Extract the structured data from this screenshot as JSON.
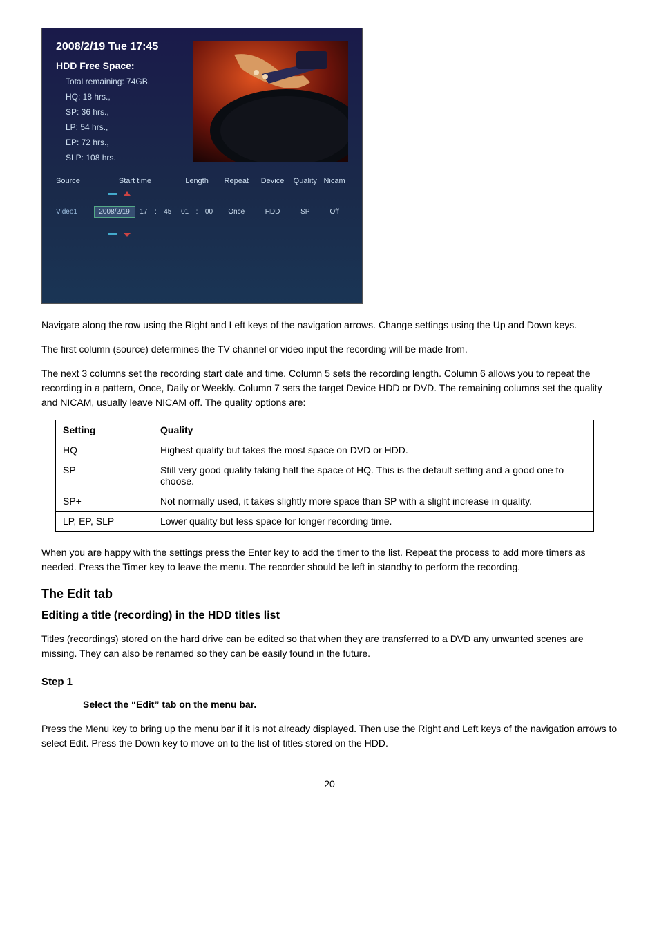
{
  "screenshot": {
    "datetime": "2008/2/19 Tue 17:45",
    "freespace_title": "HDD Free Space:",
    "lines": {
      "total": "Total remaining: 74GB.",
      "hq": "HQ: 18 hrs.,",
      "sp": "SP: 36 hrs.,",
      "lp": "LP: 54 hrs.,",
      "ep": "EP: 72 hrs.,",
      "slp": "SLP: 108 hrs."
    },
    "headers": {
      "source": "Source",
      "start_time": "Start time",
      "length": "Length",
      "repeat": "Repeat",
      "device": "Device",
      "quality": "Quality",
      "nicam": "Nicam"
    },
    "row": {
      "source": "Video1",
      "date": "2008/2/19",
      "hh": "17",
      "sep": ":",
      "mm": "45",
      "len_hh": "01",
      "len_mm": "00",
      "repeat": "Once",
      "device": "HDD",
      "quality": "SP",
      "nicam": "Off"
    }
  },
  "paragraphs": {
    "p1": "Navigate along the row using the Right and Left keys of the navigation arrows. Change settings using the Up and Down keys.",
    "p2": "The first column (source) determines the TV channel or video input the recording will be made from.",
    "p3": "The next 3 columns set the recording start date and time. Column 5 sets the recording length. Column 6 allows you to repeat the recording in a pattern, Once, Daily or Weekly. Column 7 sets the target Device HDD or DVD. The remaining columns set the quality and NICAM, usually leave NICAM off. The quality options are:",
    "p4": "When you are happy with the settings press the Enter key to add the timer to the list. Repeat the process to add more timers as needed. Press the Timer key to leave the menu. The recorder should be left in standby to perform the recording."
  },
  "quality_table": {
    "head_setting": "Setting",
    "head_quality": "Quality",
    "rows": [
      {
        "setting": "HQ",
        "quality": "Highest quality but takes the most space on DVD or HDD."
      },
      {
        "setting": "SP",
        "quality": "Still very good quality taking half the space of HQ. This is the default setting and a good one to choose."
      },
      {
        "setting": "SP+",
        "quality": "Not normally used, it takes slightly more space than SP with a slight increase in quality."
      },
      {
        "setting": "LP, EP, SLP",
        "quality": "Lower quality but less space for longer recording time."
      }
    ]
  },
  "edit_section": {
    "title": "The Edit tab",
    "sub": "Editing a title (recording) in the HDD titles list",
    "p1": "Titles (recordings) stored on the hard drive can be edited so that when they are transferred to a DVD any unwanted scenes are missing. They can also be renamed so they can be easily found in the future.",
    "step1_title": "Step 1",
    "step1_body": "Select the “Edit” tab on the menu bar.",
    "step1_after": "Press the Menu key to bring up the menu bar if it is not already displayed. Then use the Right and Left keys of the navigation arrows to select Edit. Press the Down key to move on to the list of titles stored on the HDD."
  },
  "page_number": "20"
}
